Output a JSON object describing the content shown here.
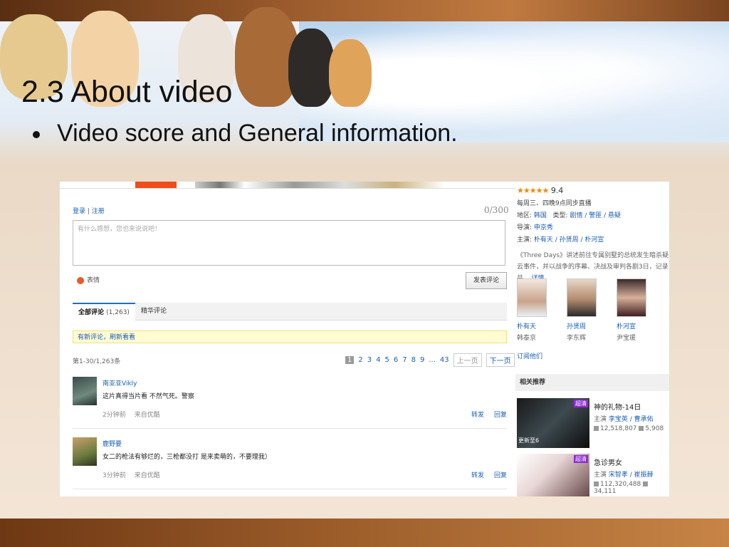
{
  "slide": {
    "title": "2.3 About video",
    "bullet": "Video score and General information."
  },
  "screenshot": {
    "login": "登录",
    "register": "注册",
    "char_counter": "0/300",
    "comment_placeholder": "有什么感想，您也来说说吧！",
    "emoji_label": "表情",
    "post_button": "发表评论",
    "tabs": [
      {
        "label": "全部评论",
        "count": "(1,263)"
      },
      {
        "label": "精华评论"
      }
    ],
    "notice": "有新评论，刷新看看",
    "range_text": "第1-30/1,263条",
    "pagination": {
      "pages": [
        "2",
        "3",
        "4",
        "5",
        "6",
        "7",
        "8",
        "9"
      ],
      "ellipsis": "...",
      "last": "43",
      "prev": "上一页",
      "next": "下一页"
    },
    "comments": [
      {
        "user": "南亚亚Vikly",
        "text": "这片真得当片看 不然气死。警察",
        "time": "2分钟前",
        "source": "来自优酷",
        "repost": "转发",
        "reply": "回复"
      },
      {
        "user": "鹿野要",
        "text": "女二的枪法有够烂的，三枪都没打                                                                                                                 是来卖萌的，不要理我）",
        "time": "3分钟前",
        "source": "来自优酷",
        "repost": "转发",
        "reply": "回复"
      }
    ],
    "info": {
      "rating_stars": "★★★★★",
      "rating": "9.4",
      "schedule": "每周三、四晚9点同步直播",
      "region_label": "地区:",
      "region": "韩国",
      "type_label": "类型:",
      "types": "剧情 / 警匪 / 悬疑",
      "director_label": "导演:",
      "director": "申京秀",
      "cast_label": "主演:",
      "cast": "朴有天 / 孙贤周 / 朴河宣",
      "description": "《Three Days》讲述前往专属别墅的总统发生暗杀疑云事件，并以战争的序幕、决战及审判各剧3日，记录共...",
      "desc_more": "详情",
      "actors": [
        {
          "name": "朴有天",
          "role": "韩泰京"
        },
        {
          "name": "孙贤周",
          "role": "李东辉"
        },
        {
          "name": "朴河宣",
          "role": "尹宝瑗"
        }
      ],
      "subscribe": "订阅他们"
    },
    "related": {
      "heading": "相关推荐",
      "items": [
        {
          "badge": "超清",
          "update": "更新至6",
          "title": "神的礼物-14日",
          "cast_label": "主演",
          "cast": "李宝英 / 曹承佑",
          "plays": "12,518,807",
          "comments": "5,908"
        },
        {
          "badge": "超清",
          "title": "急诊男女",
          "cast_label": "主演",
          "cast": "宋智孝 / 崔振赫",
          "plays": "112,320,488",
          "comments": "34,111"
        }
      ]
    }
  }
}
